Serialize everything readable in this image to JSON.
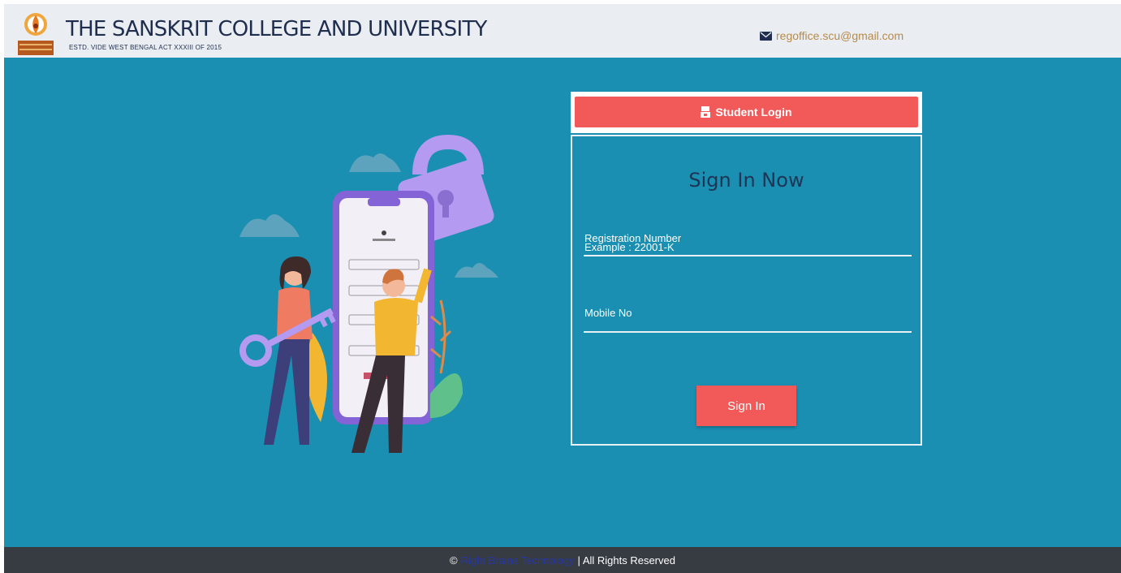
{
  "header": {
    "title": "THE SANSKRIT COLLEGE AND UNIVERSITY",
    "subtitle": "ESTD. VIDE WEST BENGAL ACT XXXIII OF 2015",
    "email": "regoffice.scu@gmail.com",
    "email_icon": "envelope-icon",
    "logo": "university-emblem"
  },
  "login": {
    "tab_label": "Student Login",
    "tab_icon": "student-icon",
    "heading": "Sign In Now",
    "registration_label": "Registration Number",
    "registration_example": "Example : 22001-K",
    "mobile_label": "Mobile No",
    "signin_button": "Sign In"
  },
  "footer": {
    "copyright_symbol": "©",
    "brand": "Right Brains Technology",
    "rights": "| All Rights Reserved"
  },
  "colors": {
    "background": "#1a8fb1",
    "accent": "#f25a5a",
    "header_bg": "#eaeef2",
    "footer_bg": "#373c42"
  }
}
